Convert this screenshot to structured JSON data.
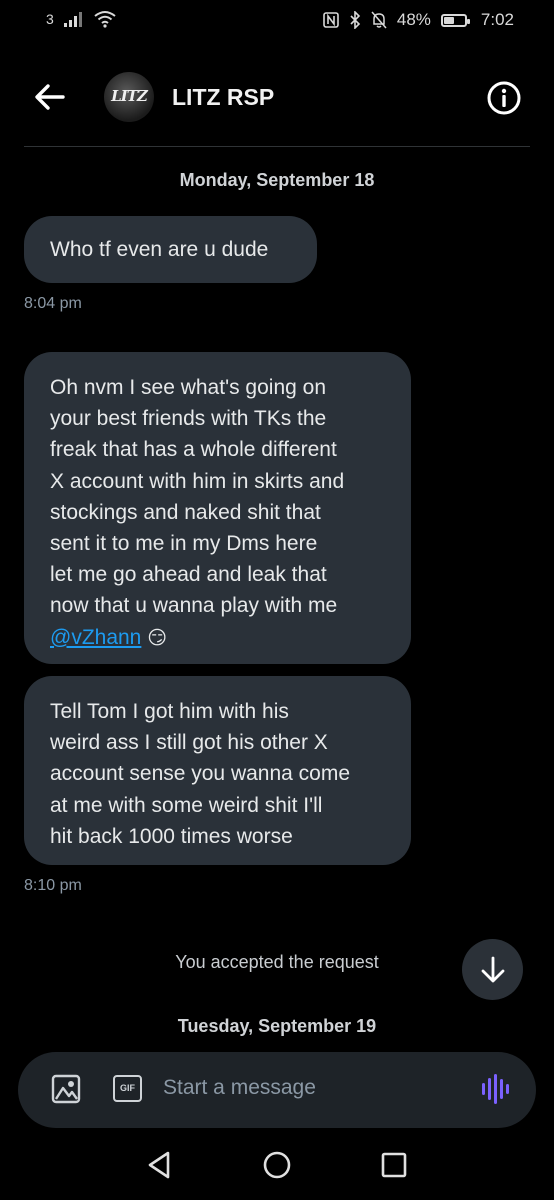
{
  "status_bar": {
    "carrier_text": "3",
    "battery": "48%",
    "battery_level": 0.48,
    "time": "7:02",
    "icons": [
      "signal-icon",
      "wifi-icon",
      "nfc-icon",
      "bluetooth-icon",
      "mute-icon",
      "battery-icon"
    ]
  },
  "header": {
    "title": "LITZ RSP",
    "avatar_text": "LITZ"
  },
  "conversation": {
    "date_1": "Monday, September 18",
    "messages": [
      {
        "text": "Who tf even are u dude"
      },
      {
        "lines": [
          "Oh nvm I see what's going on",
          "your best friends with TKs the",
          "freak that has a whole different",
          "X account with him in skirts and",
          "stockings and naked shit that",
          "sent it to me in my Dms here",
          "let me go ahead and leak that",
          "now that u wanna play with me"
        ],
        "mention": "@vZhann",
        "emoji": "😏"
      },
      {
        "lines": [
          "Tell Tom I got him with his",
          "weird ass I still got his other X",
          "account sense you wanna come",
          "at me with some weird shit I'll",
          "hit back 1000 times worse"
        ]
      }
    ],
    "time_1": "8:04 pm",
    "time_2": "8:10 pm",
    "system_message": "You accepted the request",
    "date_2": "Tuesday, September 19"
  },
  "composer": {
    "gif_label": "GIF",
    "placeholder": "Start a message"
  },
  "colors": {
    "background": "#000000",
    "bubble": "#2a3139",
    "accent": "#1d9bf0",
    "voice": "#7b61ff"
  }
}
